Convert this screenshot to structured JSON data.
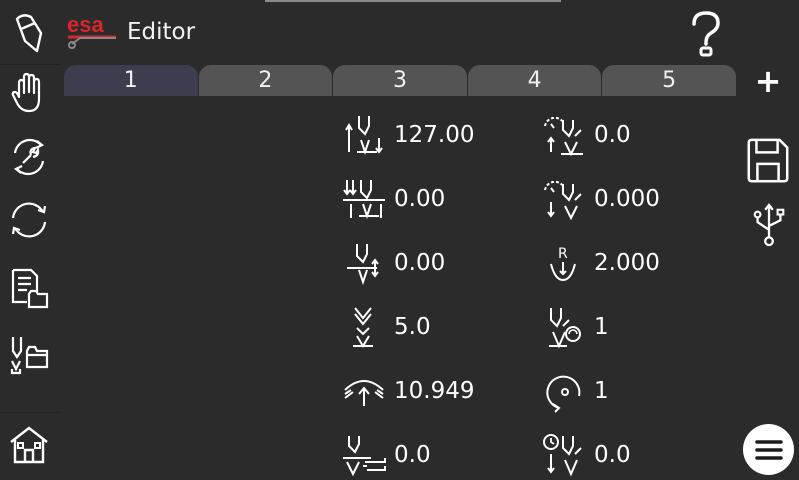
{
  "header": {
    "logo_text": "esa",
    "title": "Editor"
  },
  "tabs": [
    {
      "label": "1",
      "active": true
    },
    {
      "label": "2",
      "active": false
    },
    {
      "label": "3",
      "active": false
    },
    {
      "label": "4",
      "active": false
    },
    {
      "label": "5",
      "active": false
    }
  ],
  "toolbar": {
    "add_label": "+"
  },
  "params_left": [
    {
      "icon": "y-axis-position-icon",
      "value": "127.00"
    },
    {
      "icon": "y-axis-opening-icon",
      "value": "0.00"
    },
    {
      "icon": "x-axis-position-icon",
      "value": "0.00"
    },
    {
      "icon": "speed-change-icon",
      "value": "5.0"
    },
    {
      "icon": "crowning-icon",
      "value": "10.949"
    },
    {
      "icon": "x-retract-icon",
      "value": "0.0"
    }
  ],
  "params_right": [
    {
      "icon": "upper-dead-point-time-icon",
      "value": "0.0"
    },
    {
      "icon": "lower-dead-point-time-icon",
      "value": "0.000"
    },
    {
      "icon": "radius-icon",
      "value": "2.000"
    },
    {
      "icon": "repeat-bend-icon",
      "value": "1"
    },
    {
      "icon": "cycle-icon",
      "value": "1"
    },
    {
      "icon": "decompression-time-icon",
      "value": "0.0"
    }
  ],
  "colors": {
    "background": "#2b2b2b",
    "tab": "#545454",
    "tab_active": "#3c3d4e",
    "brand": "#d9252b"
  }
}
